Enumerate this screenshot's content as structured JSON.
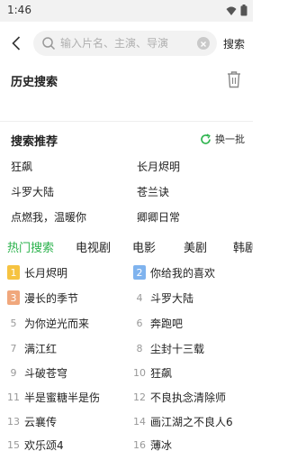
{
  "status_bar": {
    "time": "1:46"
  },
  "search": {
    "placeholder": "输入片名、主演、导演",
    "button_label": "搜索"
  },
  "history": {
    "title": "历史搜索"
  },
  "recommend": {
    "title": "搜索推荐",
    "refresh_label": "换一批",
    "items": [
      "狂飙",
      "长月烬明",
      "斗罗大陆",
      "苍兰诀",
      "点燃我，温暖你",
      "卿卿日常"
    ]
  },
  "tabs": [
    "热门搜索",
    "电视剧",
    "电影",
    "美剧",
    "韩剧"
  ],
  "hot_list": [
    {
      "rank": "1",
      "title": "长月烬明"
    },
    {
      "rank": "2",
      "title": "你给我的喜欢"
    },
    {
      "rank": "3",
      "title": "漫长的季节"
    },
    {
      "rank": "4",
      "title": "斗罗大陆"
    },
    {
      "rank": "5",
      "title": "为你逆光而来"
    },
    {
      "rank": "6",
      "title": "奔跑吧"
    },
    {
      "rank": "7",
      "title": "满江红"
    },
    {
      "rank": "8",
      "title": "尘封十三载"
    },
    {
      "rank": "9",
      "title": "斗破苍穹"
    },
    {
      "rank": "10",
      "title": "狂飙"
    },
    {
      "rank": "11",
      "title": "半是蜜糖半是伤"
    },
    {
      "rank": "12",
      "title": "不良执念清除师"
    },
    {
      "rank": "13",
      "title": "云襄传"
    },
    {
      "rank": "14",
      "title": "画江湖之不良人6"
    },
    {
      "rank": "15",
      "title": "欢乐颂4"
    },
    {
      "rank": "16",
      "title": "薄冰"
    }
  ],
  "colors": {
    "accent": "#2bb24c",
    "rank1": "#f6c341",
    "rank2": "#7fb3ee",
    "rank3": "#f0a77c"
  }
}
